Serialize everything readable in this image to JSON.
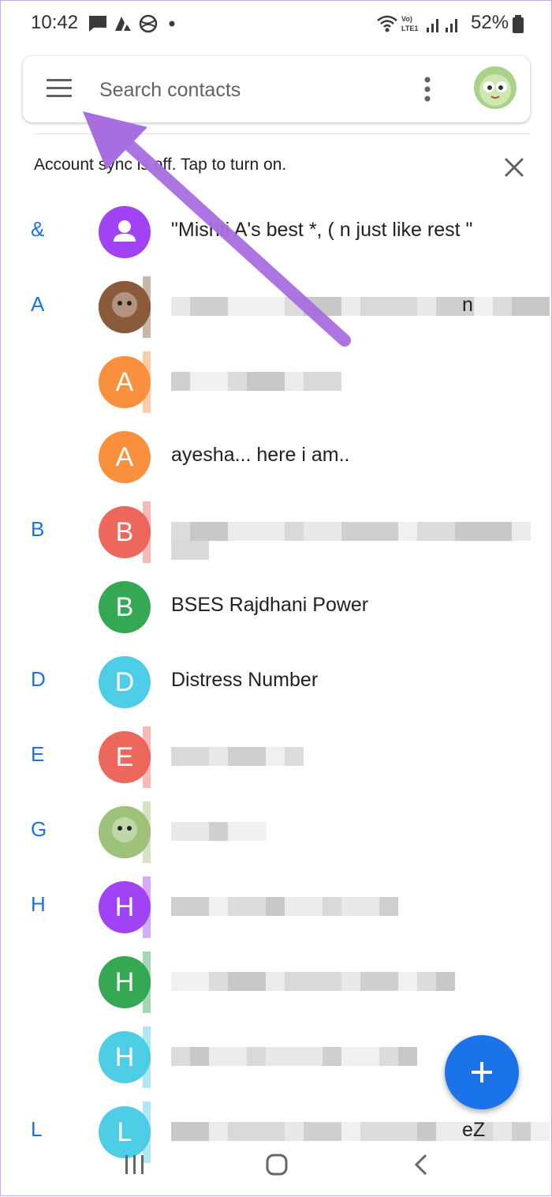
{
  "status_bar": {
    "time": "10:42",
    "network_label": "Vo) LTE1",
    "battery": "52%"
  },
  "search": {
    "placeholder": "Search contacts"
  },
  "sync_banner": {
    "text": "Account sync is off. Tap to turn on."
  },
  "contacts": [
    {
      "letter": "&",
      "initial": "",
      "name": "\"Mishti A's best *, ( n just like rest \"",
      "avatar_color": "#a142f4",
      "avatar_kind": "person-icon"
    },
    {
      "letter": "A",
      "initial": "",
      "name": "",
      "tail": "n",
      "avatar_color": "#8a5a3a",
      "avatar_kind": "photo"
    },
    {
      "letter": "",
      "initial": "A",
      "name": "",
      "avatar_color": "#fa903e",
      "avatar_kind": "initial"
    },
    {
      "letter": "",
      "initial": "A",
      "name": "ayesha... here i am..",
      "avatar_color": "#fa903e",
      "avatar_kind": "initial"
    },
    {
      "letter": "B",
      "initial": "B",
      "name": "",
      "avatar_color": "#ee675c",
      "avatar_kind": "initial"
    },
    {
      "letter": "",
      "initial": "B",
      "name": "BSES Rajdhani Power",
      "avatar_color": "#34a853",
      "avatar_kind": "initial"
    },
    {
      "letter": "D",
      "initial": "D",
      "name": "Distress Number",
      "avatar_color": "#4ecde6",
      "avatar_kind": "initial"
    },
    {
      "letter": "E",
      "initial": "E",
      "name": "",
      "avatar_color": "#ee675c",
      "avatar_kind": "initial"
    },
    {
      "letter": "G",
      "initial": "",
      "name": "",
      "avatar_color": "#9fc27a",
      "avatar_kind": "photo"
    },
    {
      "letter": "H",
      "initial": "H",
      "name": "",
      "avatar_color": "#a142f4",
      "avatar_kind": "initial"
    },
    {
      "letter": "",
      "initial": "H",
      "name": "",
      "avatar_color": "#34a853",
      "avatar_kind": "initial"
    },
    {
      "letter": "",
      "initial": "H",
      "name": "",
      "avatar_color": "#4ecde6",
      "avatar_kind": "initial"
    },
    {
      "letter": "L",
      "initial": "L",
      "name": "",
      "tail": "eZ",
      "avatar_color": "#4ecde6",
      "avatar_kind": "initial"
    }
  ],
  "colors": {
    "accent": "#1a73e8",
    "annotation_arrow": "#a86ee0"
  },
  "icons": {
    "menu": "hamburger-menu-icon",
    "more": "more-vert-icon",
    "close": "close-icon",
    "fab": "add-icon",
    "nav_recents": "recents-icon",
    "nav_home": "home-icon",
    "nav_back": "back-icon"
  }
}
